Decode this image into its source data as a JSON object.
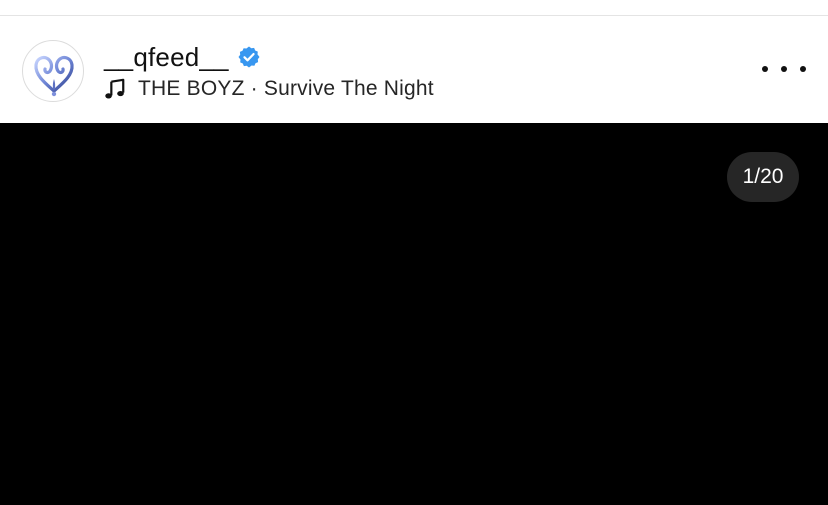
{
  "post": {
    "username": "__qfeed__",
    "verified": true,
    "verified_color": "#3897f0",
    "avatar_icon": "heart-logo",
    "music_icon": "music-note-icon",
    "song": "THE BOYZ · Survive The Night",
    "more_icon": "more-options-icon"
  },
  "media": {
    "background": "#000000",
    "counter": "1/20"
  }
}
